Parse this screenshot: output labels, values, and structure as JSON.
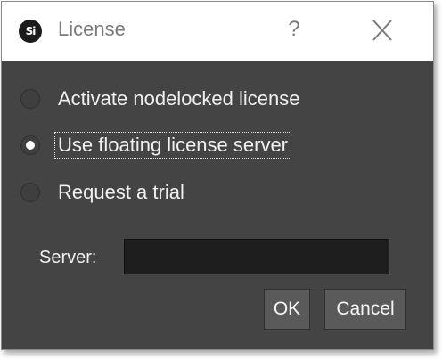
{
  "window": {
    "title": "License",
    "app_icon_text": "Si",
    "help_label": "?",
    "close_icon": "close-icon"
  },
  "options": [
    {
      "label": "Activate nodelocked license",
      "checked": false
    },
    {
      "label": "Use floating license server",
      "checked": true
    },
    {
      "label": "Request a trial",
      "checked": false
    }
  ],
  "server": {
    "label": "Server:",
    "value": ""
  },
  "buttons": {
    "ok_label": "OK",
    "cancel_label": "Cancel"
  },
  "colors": {
    "dialog_bg": "#444444",
    "titlebar_bg": "#ffffff",
    "text": "#f0f0f0",
    "input_bg": "#1e1e1e",
    "button_bg": "#5a5a5a"
  }
}
